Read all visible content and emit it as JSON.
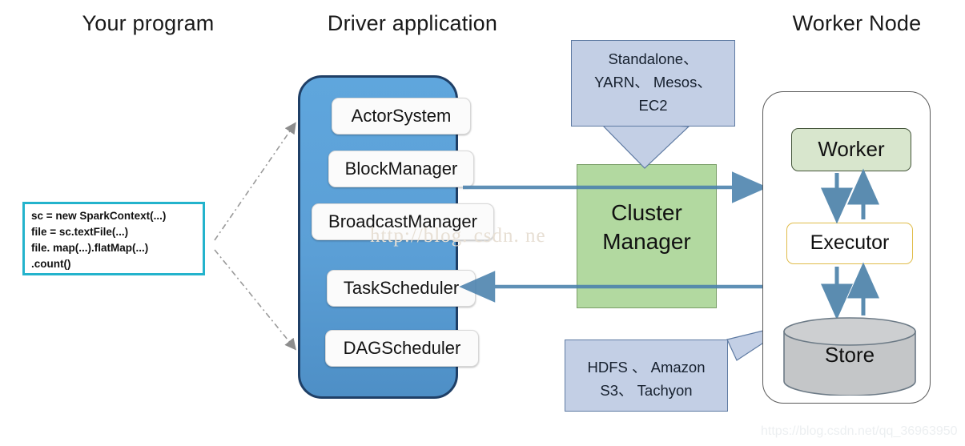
{
  "headings": {
    "program": "Your program",
    "driver": "Driver application",
    "worker": "Worker Node"
  },
  "code_box": {
    "lines": [
      "sc = new SparkContext(...)",
      "file = sc.textFile(...)",
      "file. map(...).flatMap(...)",
      ".count()"
    ],
    "border_color": "#23b3cc"
  },
  "driver": {
    "fill_color": "#5b9fd6",
    "border_color": "#1f3f66",
    "items": [
      {
        "label": "ActorSystem"
      },
      {
        "label": "BlockManager"
      },
      {
        "label": "BroadcastManager"
      },
      {
        "label": "TaskScheduler"
      },
      {
        "label": "DAGScheduler"
      }
    ]
  },
  "cluster_manager": {
    "line1": "Cluster",
    "line2": "Manager",
    "fill_color": "#b2d9a0",
    "border_color": "#7a9e68"
  },
  "callouts": {
    "top": {
      "line1": "Standalone、",
      "line2": "YARN、 Mesos、",
      "line3": "EC2",
      "fill_color": "#c3cfe5",
      "border_color": "#5f7ba3"
    },
    "bottom": {
      "line1": "HDFS 、 Amazon",
      "line2": "S3、 Tachyon",
      "fill_color": "#c3cfe5",
      "border_color": "#5f7ba3"
    }
  },
  "worker_node": {
    "worker": {
      "label": "Worker",
      "fill_color": "#d8e6cd",
      "border_color": "#44553a"
    },
    "executor": {
      "label": "Executor",
      "fill_color": "#ffffff",
      "border_color": "#e0bc4a"
    },
    "store": {
      "label": "Store",
      "fill_color": "#c4c6c8",
      "border_color": "#6c7a86"
    },
    "panel_border_color": "#595959"
  },
  "arrows": {
    "color": "#4a81ad",
    "dash_color": "#9a9a9a",
    "top_direction": "right",
    "bottom_direction": "left"
  },
  "watermarks": {
    "center": "http://blog. csdn. ne",
    "corner": "https://blog.csdn.net/qq_36963950"
  }
}
